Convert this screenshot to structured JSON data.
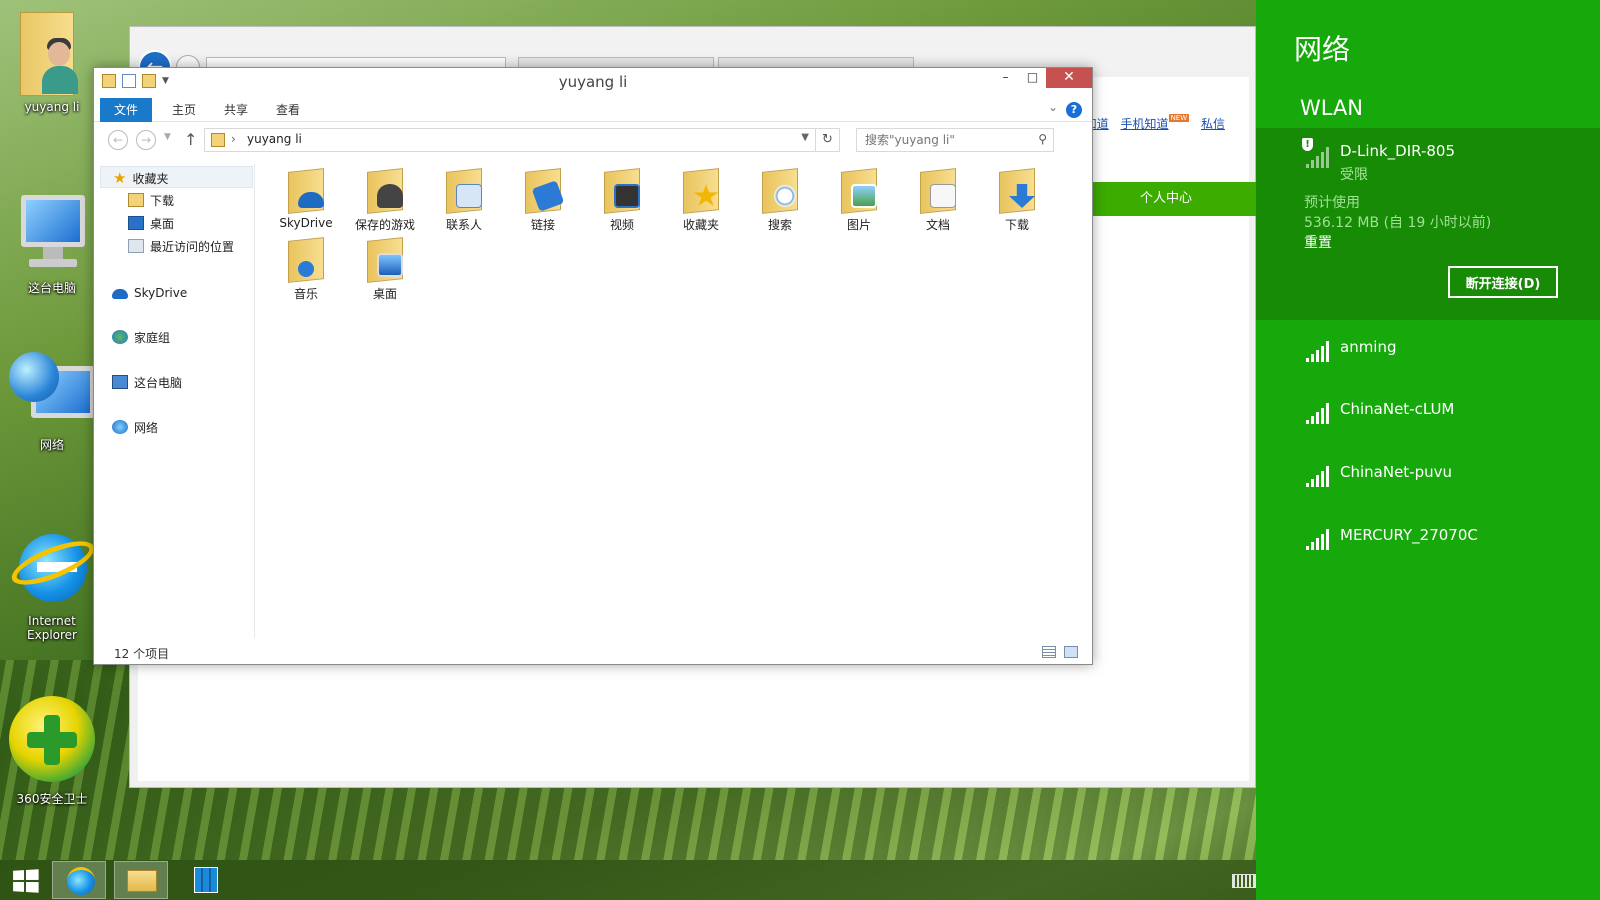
{
  "desktop": {
    "icons": [
      {
        "label": "yuyang li",
        "icon": "user-folder-icon"
      },
      {
        "label": "这台电脑",
        "icon": "computer-icon"
      },
      {
        "label": "网络",
        "icon": "network-icon"
      },
      {
        "label": "Internet Explorer",
        "icon": "ie-icon"
      },
      {
        "label": "360安全卫士",
        "icon": "360-safe-icon"
      }
    ]
  },
  "browser": {
    "links": [
      "知道",
      "手机知道",
      "私信"
    ],
    "new_badge": "NEW",
    "user_center": "个人中心"
  },
  "explorer": {
    "title": "yuyang li",
    "ribbon_tabs": [
      "文件",
      "主页",
      "共享",
      "查看"
    ],
    "help_label": "?",
    "path": "yuyang li",
    "search_placeholder": "搜索\"yuyang li\"",
    "nav": {
      "favorites": "收藏夹",
      "downloads": "下载",
      "desktop": "桌面",
      "recent": "最近访问的位置",
      "skydrive": "SkyDrive",
      "homegroup": "家庭组",
      "this_pc": "这台电脑",
      "network": "网络"
    },
    "items": [
      {
        "label": "SkyDrive",
        "icon": "skydrive-folder-icon"
      },
      {
        "label": "保存的游戏",
        "icon": "saved-games-folder-icon"
      },
      {
        "label": "联系人",
        "icon": "contacts-folder-icon"
      },
      {
        "label": "链接",
        "icon": "links-folder-icon"
      },
      {
        "label": "视频",
        "icon": "videos-folder-icon"
      },
      {
        "label": "收藏夹",
        "icon": "favorites-folder-icon"
      },
      {
        "label": "搜索",
        "icon": "searches-folder-icon"
      },
      {
        "label": "图片",
        "icon": "pictures-folder-icon"
      },
      {
        "label": "文档",
        "icon": "documents-folder-icon"
      },
      {
        "label": "下载",
        "icon": "downloads-folder-icon"
      },
      {
        "label": "音乐",
        "icon": "music-folder-icon"
      },
      {
        "label": "桌面",
        "icon": "desktop-folder-icon"
      }
    ],
    "status_count": "12 个项目"
  },
  "network_panel": {
    "title": "网络",
    "section": "WLAN",
    "connected": {
      "ssid": "D-Link_DIR-805",
      "status": "受限",
      "usage_label": "预计使用",
      "usage_value": "536.12 MB (自 19 小时以前)",
      "reset_label": "重置",
      "disconnect_label": "断开连接(D)"
    },
    "networks": [
      "anming",
      "ChinaNet-cLUM",
      "ChinaNet-puvu",
      "MERCURY_27070C"
    ]
  },
  "colors": {
    "panel_bg": "#17a80c",
    "panel_selected_bg": "#178a06",
    "ribbon_file_tab": "#1979ca",
    "close_button": "#c75050"
  }
}
